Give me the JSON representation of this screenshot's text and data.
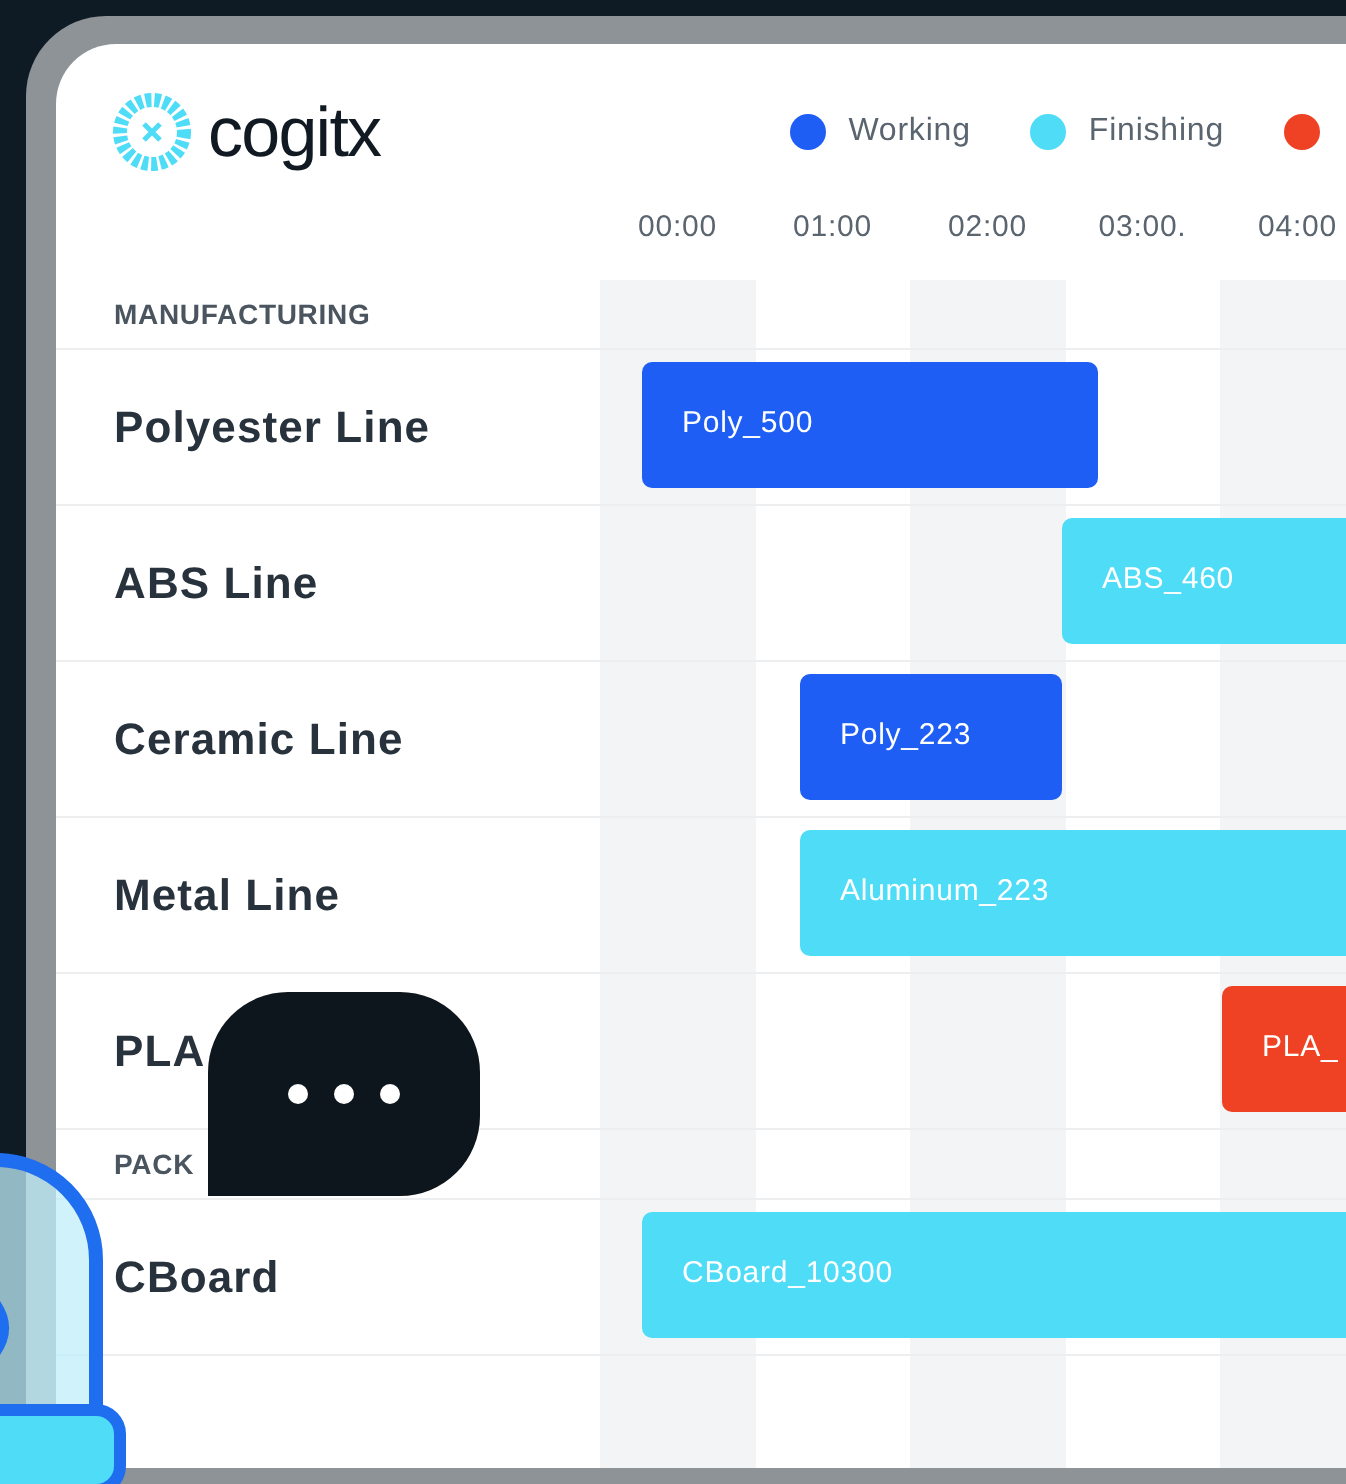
{
  "brand": {
    "name": "cogitx"
  },
  "legend": [
    {
      "label": "Working",
      "color": "#1f5ef5"
    },
    {
      "label": "Finishing",
      "color": "#4fdcf7"
    },
    {
      "color": "#ef4123"
    }
  ],
  "timeline": {
    "hours": [
      "00:00",
      "01:00",
      "02:00",
      "03:00.",
      "04:00"
    ]
  },
  "sections": [
    {
      "title": "MANUFACTURING",
      "rows": [
        {
          "name": "Polyester Line",
          "bar": {
            "label": "Poly_500",
            "color": "#1f5ef5"
          }
        },
        {
          "name": "ABS Line",
          "bar": {
            "label": "ABS_460",
            "color": "#4fdcf7"
          }
        },
        {
          "name": "Ceramic Line",
          "bar": {
            "label": "Poly_223",
            "color": "#1f5ef5"
          }
        },
        {
          "name": "Metal Line",
          "bar": {
            "label": "Aluminum_223",
            "color": "#4fdcf7"
          }
        },
        {
          "name": "PLA",
          "bar": {
            "label": "PLA_",
            "color": "#ef4123"
          }
        }
      ]
    },
    {
      "title": "PACK",
      "rows": [
        {
          "name": "CBoard",
          "bar": {
            "label": "CBoard_10300",
            "color": "#4fdcf7"
          }
        }
      ]
    }
  ]
}
